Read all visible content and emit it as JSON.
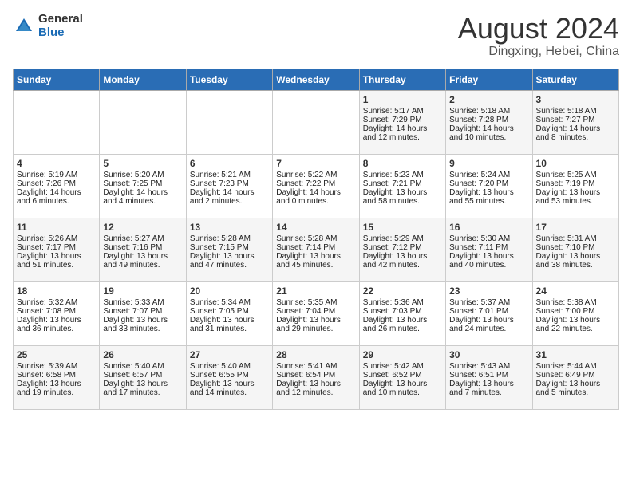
{
  "header": {
    "logo_general": "General",
    "logo_blue": "Blue",
    "title": "August 2024",
    "subtitle": "Dingxing, Hebei, China"
  },
  "days_of_week": [
    "Sunday",
    "Monday",
    "Tuesday",
    "Wednesday",
    "Thursday",
    "Friday",
    "Saturday"
  ],
  "weeks": [
    [
      {
        "day": "",
        "info": ""
      },
      {
        "day": "",
        "info": ""
      },
      {
        "day": "",
        "info": ""
      },
      {
        "day": "",
        "info": ""
      },
      {
        "day": "1",
        "info": "Sunrise: 5:17 AM\nSunset: 7:29 PM\nDaylight: 14 hours\nand 12 minutes."
      },
      {
        "day": "2",
        "info": "Sunrise: 5:18 AM\nSunset: 7:28 PM\nDaylight: 14 hours\nand 10 minutes."
      },
      {
        "day": "3",
        "info": "Sunrise: 5:18 AM\nSunset: 7:27 PM\nDaylight: 14 hours\nand 8 minutes."
      }
    ],
    [
      {
        "day": "4",
        "info": "Sunrise: 5:19 AM\nSunset: 7:26 PM\nDaylight: 14 hours\nand 6 minutes."
      },
      {
        "day": "5",
        "info": "Sunrise: 5:20 AM\nSunset: 7:25 PM\nDaylight: 14 hours\nand 4 minutes."
      },
      {
        "day": "6",
        "info": "Sunrise: 5:21 AM\nSunset: 7:23 PM\nDaylight: 14 hours\nand 2 minutes."
      },
      {
        "day": "7",
        "info": "Sunrise: 5:22 AM\nSunset: 7:22 PM\nDaylight: 14 hours\nand 0 minutes."
      },
      {
        "day": "8",
        "info": "Sunrise: 5:23 AM\nSunset: 7:21 PM\nDaylight: 13 hours\nand 58 minutes."
      },
      {
        "day": "9",
        "info": "Sunrise: 5:24 AM\nSunset: 7:20 PM\nDaylight: 13 hours\nand 55 minutes."
      },
      {
        "day": "10",
        "info": "Sunrise: 5:25 AM\nSunset: 7:19 PM\nDaylight: 13 hours\nand 53 minutes."
      }
    ],
    [
      {
        "day": "11",
        "info": "Sunrise: 5:26 AM\nSunset: 7:17 PM\nDaylight: 13 hours\nand 51 minutes."
      },
      {
        "day": "12",
        "info": "Sunrise: 5:27 AM\nSunset: 7:16 PM\nDaylight: 13 hours\nand 49 minutes."
      },
      {
        "day": "13",
        "info": "Sunrise: 5:28 AM\nSunset: 7:15 PM\nDaylight: 13 hours\nand 47 minutes."
      },
      {
        "day": "14",
        "info": "Sunrise: 5:28 AM\nSunset: 7:14 PM\nDaylight: 13 hours\nand 45 minutes."
      },
      {
        "day": "15",
        "info": "Sunrise: 5:29 AM\nSunset: 7:12 PM\nDaylight: 13 hours\nand 42 minutes."
      },
      {
        "day": "16",
        "info": "Sunrise: 5:30 AM\nSunset: 7:11 PM\nDaylight: 13 hours\nand 40 minutes."
      },
      {
        "day": "17",
        "info": "Sunrise: 5:31 AM\nSunset: 7:10 PM\nDaylight: 13 hours\nand 38 minutes."
      }
    ],
    [
      {
        "day": "18",
        "info": "Sunrise: 5:32 AM\nSunset: 7:08 PM\nDaylight: 13 hours\nand 36 minutes."
      },
      {
        "day": "19",
        "info": "Sunrise: 5:33 AM\nSunset: 7:07 PM\nDaylight: 13 hours\nand 33 minutes."
      },
      {
        "day": "20",
        "info": "Sunrise: 5:34 AM\nSunset: 7:05 PM\nDaylight: 13 hours\nand 31 minutes."
      },
      {
        "day": "21",
        "info": "Sunrise: 5:35 AM\nSunset: 7:04 PM\nDaylight: 13 hours\nand 29 minutes."
      },
      {
        "day": "22",
        "info": "Sunrise: 5:36 AM\nSunset: 7:03 PM\nDaylight: 13 hours\nand 26 minutes."
      },
      {
        "day": "23",
        "info": "Sunrise: 5:37 AM\nSunset: 7:01 PM\nDaylight: 13 hours\nand 24 minutes."
      },
      {
        "day": "24",
        "info": "Sunrise: 5:38 AM\nSunset: 7:00 PM\nDaylight: 13 hours\nand 22 minutes."
      }
    ],
    [
      {
        "day": "25",
        "info": "Sunrise: 5:39 AM\nSunset: 6:58 PM\nDaylight: 13 hours\nand 19 minutes."
      },
      {
        "day": "26",
        "info": "Sunrise: 5:40 AM\nSunset: 6:57 PM\nDaylight: 13 hours\nand 17 minutes."
      },
      {
        "day": "27",
        "info": "Sunrise: 5:40 AM\nSunset: 6:55 PM\nDaylight: 13 hours\nand 14 minutes."
      },
      {
        "day": "28",
        "info": "Sunrise: 5:41 AM\nSunset: 6:54 PM\nDaylight: 13 hours\nand 12 minutes."
      },
      {
        "day": "29",
        "info": "Sunrise: 5:42 AM\nSunset: 6:52 PM\nDaylight: 13 hours\nand 10 minutes."
      },
      {
        "day": "30",
        "info": "Sunrise: 5:43 AM\nSunset: 6:51 PM\nDaylight: 13 hours\nand 7 minutes."
      },
      {
        "day": "31",
        "info": "Sunrise: 5:44 AM\nSunset: 6:49 PM\nDaylight: 13 hours\nand 5 minutes."
      }
    ]
  ]
}
